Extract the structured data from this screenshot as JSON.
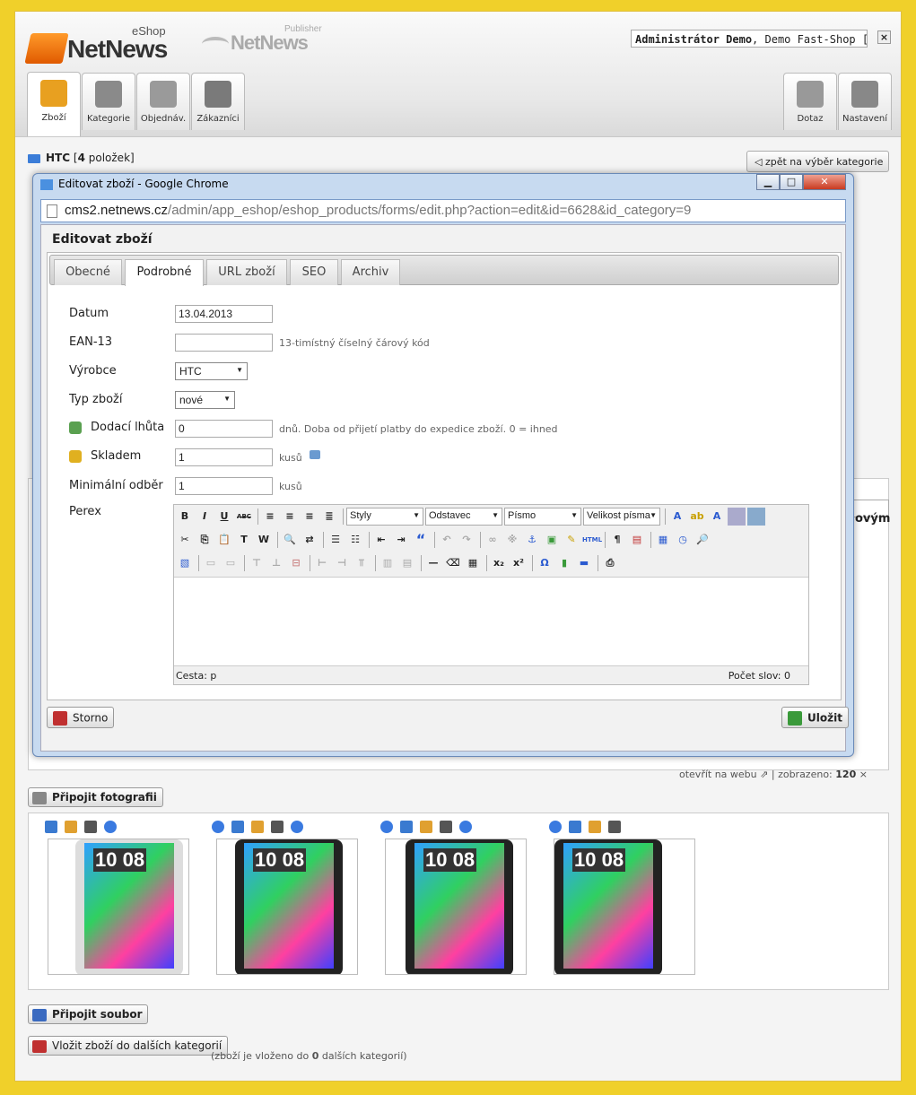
{
  "header": {
    "logo_main": "NetNews",
    "logo_main_sub": "eShop",
    "logo_second": "NetNews",
    "logo_second_sub": "Publisher",
    "user_name": "Administrátor Demo",
    "user_shop": ", Demo Fast-Shop [cz]",
    "logout_icon": "×"
  },
  "tabs_left": [
    {
      "label": "Zboží",
      "icon": "goods-icon",
      "color": "#e8a020"
    },
    {
      "label": "Kategorie",
      "icon": "category-icon",
      "color": "#8a8a8a"
    },
    {
      "label": "Objednáv.",
      "icon": "orders-icon",
      "color": "#9a9a9a"
    },
    {
      "label": "Zákazníci",
      "icon": "customers-icon",
      "color": "#7a7a7a"
    }
  ],
  "tabs_right": [
    {
      "label": "Dotaz",
      "icon": "question-icon",
      "color": "#999999"
    },
    {
      "label": "Nastavení",
      "icon": "settings-icon",
      "color": "#888888"
    }
  ],
  "category": {
    "name": "HTC",
    "count_prefix": "[",
    "count": "4",
    "count_suffix": "položek]",
    "back_label": "zpět na výběr kategorie"
  },
  "background": {
    "bold_fragment": "ovým",
    "open_web": "otevřít na webu",
    "shown_label": "zobrazeno:",
    "shown_count": "120",
    "attach_photo": "Připojit fotografii",
    "attach_file": "Připojit soubor",
    "insert_label": "Vložit zboží do dalších kategorií",
    "insert_note_prefix": "(zboží je vloženo do",
    "insert_note_count": "0",
    "insert_note_suffix": "dalších kategorií)"
  },
  "photos": [
    {
      "clock": "10 08"
    },
    {
      "clock": "10 08"
    },
    {
      "clock": "10 08"
    },
    {
      "clock": "10 08"
    }
  ],
  "window": {
    "title": "Editovat zboží - Google Chrome",
    "url_domain": "cms2.netnews.cz",
    "url_path": "/admin/app_eshop/eshop_products/forms/edit.php?action=edit&id=6628&id_category=9",
    "btn_min": "▁",
    "btn_max": "□",
    "btn_close": "✕"
  },
  "dialog": {
    "heading": "Editovat zboží",
    "tabs": [
      "Obecné",
      "Podrobné",
      "URL zboží",
      "SEO",
      "Archiv"
    ],
    "active_tab": "Podrobné",
    "fields": {
      "date_label": "Datum",
      "date_value": "13.04.2013",
      "ean_label": "EAN-13",
      "ean_value": "",
      "ean_hint": "13-timístný číselný čárový kód",
      "maker_label": "Výrobce",
      "maker_value": "HTC",
      "type_label": "Typ zboží",
      "type_value": "nové",
      "delivery_label": "Dodací lhůta",
      "delivery_value": "0",
      "delivery_hint": "dnů. Doba od přijetí platby do expedice zboží. 0 = ihned",
      "stock_label": "Skladem",
      "stock_value": "1",
      "stock_unit": "kusů",
      "min_label": "Minimální odběr",
      "min_value": "1",
      "min_unit": "kusů",
      "perex_label": "Perex"
    },
    "editor": {
      "styles": "Styly",
      "format": "Odstavec",
      "font": "Písmo",
      "size": "Velikost písma",
      "path": "Cesta: p",
      "words": "Počet slov: 0",
      "bold": "B",
      "italic": "I",
      "underline": "U",
      "strike": "ABC",
      "html": "HTML",
      "sub": "x₂",
      "sup": "x²",
      "omega": "Ω",
      "para": "¶",
      "quote": "“"
    },
    "cancel_label": "Storno",
    "save_label": "Uložit"
  }
}
